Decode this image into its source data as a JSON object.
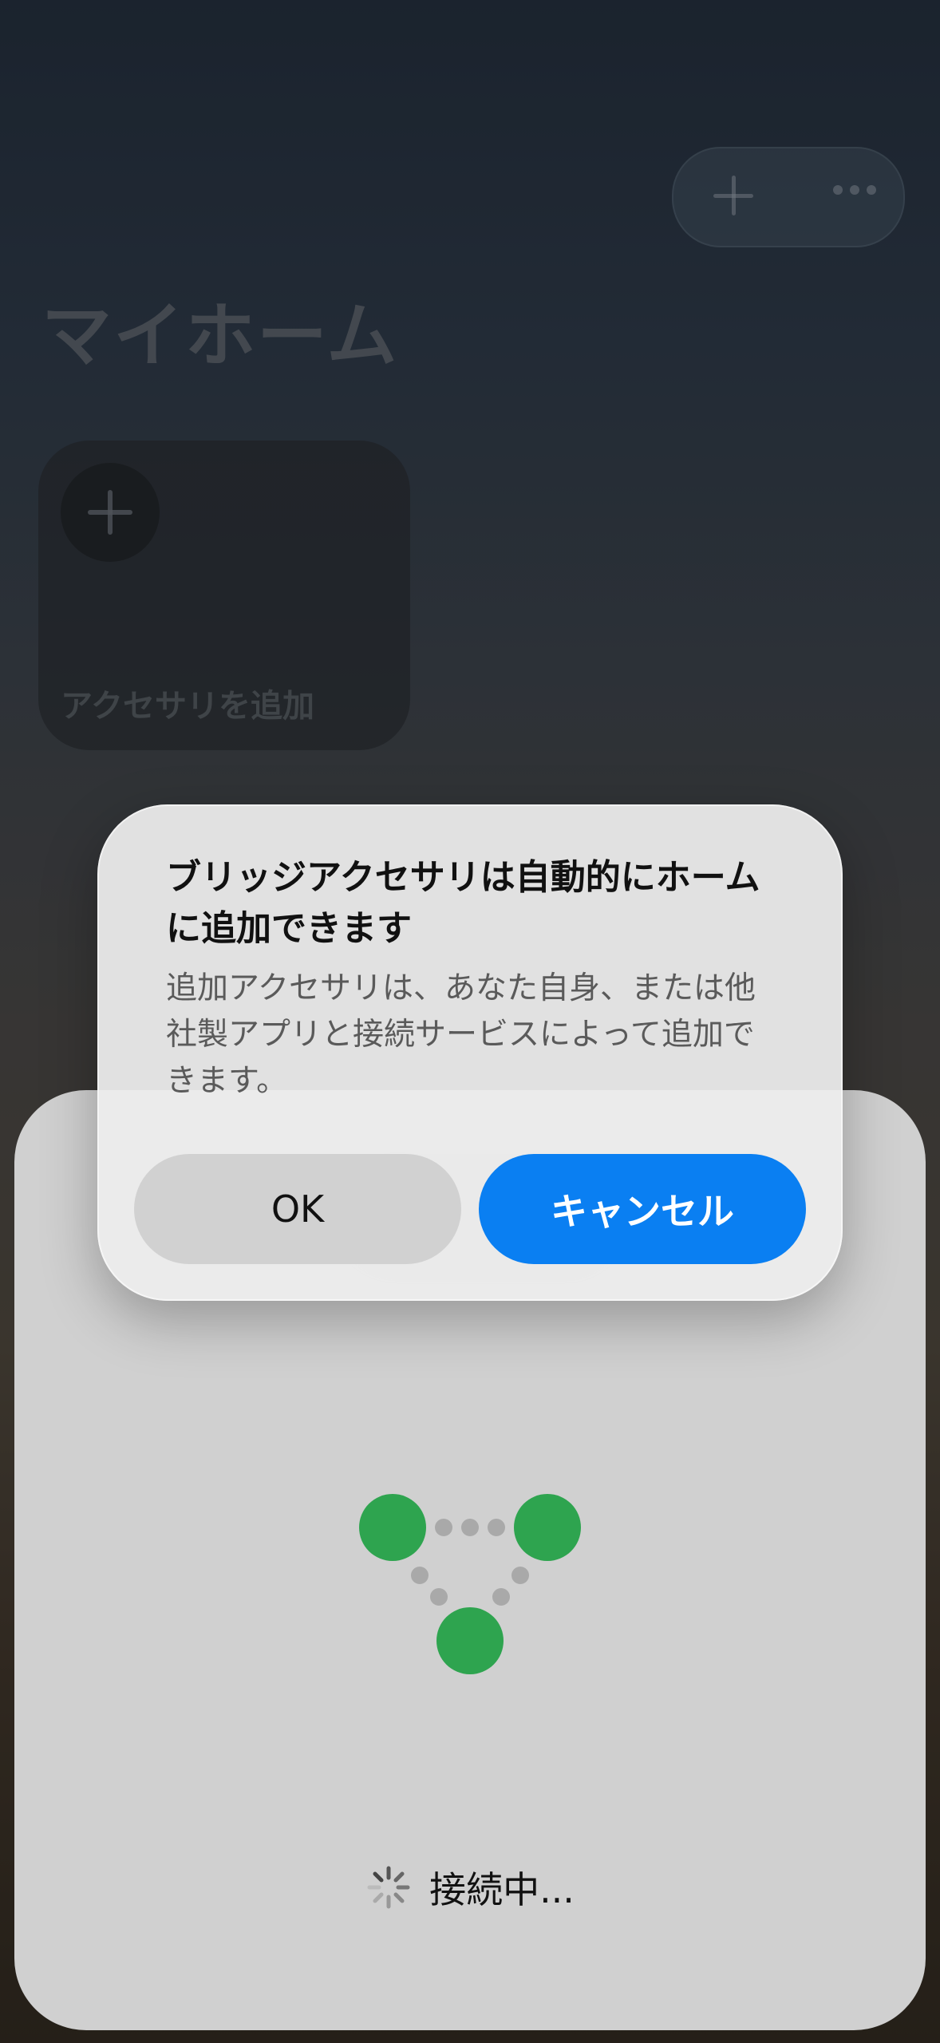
{
  "home": {
    "title": "マイホーム",
    "add_accessory_label": "アクセサリを追加",
    "header_icons": [
      "plus-icon",
      "more-icon"
    ]
  },
  "connect_sheet": {
    "status": "接続中..."
  },
  "alert": {
    "title": "ブリッジアクセサリは自動的にホームに追加できます",
    "message": "追加アクセサリは、あなた自身、または他社製アプリと接続サービスによって追加できます。",
    "ok_label": "OK",
    "cancel_label": "キャンセル"
  },
  "colors": {
    "primary_button": "#0a7ff2",
    "node_green": "#2ea44f",
    "dot_gray": "#a9a9a9"
  }
}
